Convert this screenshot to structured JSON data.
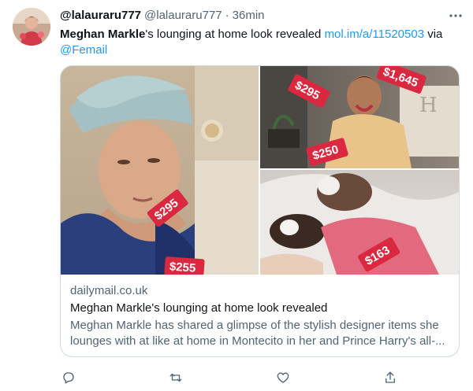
{
  "tweet": {
    "display_name": "@lalauraru777",
    "handle": "@lalauraru777",
    "separator": "·",
    "time": "36min",
    "more_icon": "more-dots-icon",
    "text_bold": "Meghan Markle",
    "text_plain": "'s lounging at home look revealed ",
    "text_link": "mol.im/a/11520503",
    "text_via": " via",
    "text_mention": "@Femail"
  },
  "card": {
    "domain": "dailymail.co.uk",
    "title": "Meghan Markle's lounging at home look revealed",
    "description": "Meghan Markle has shared a glimpse of the stylish designer items she lounges with at like at home in Montecito in her and Prince Harry's all-...",
    "price_tags": [
      "$295",
      "$255",
      "$295",
      "$1,645",
      "$250",
      "$163"
    ]
  },
  "actions": {
    "icons": [
      "reply-icon",
      "retweet-icon",
      "like-icon",
      "share-icon"
    ]
  },
  "colors": {
    "accent": "#1d9bf0",
    "text": "#0f1419",
    "secondary": "#536471",
    "border": "#cfd9de",
    "price_tag": "#d9283f"
  }
}
